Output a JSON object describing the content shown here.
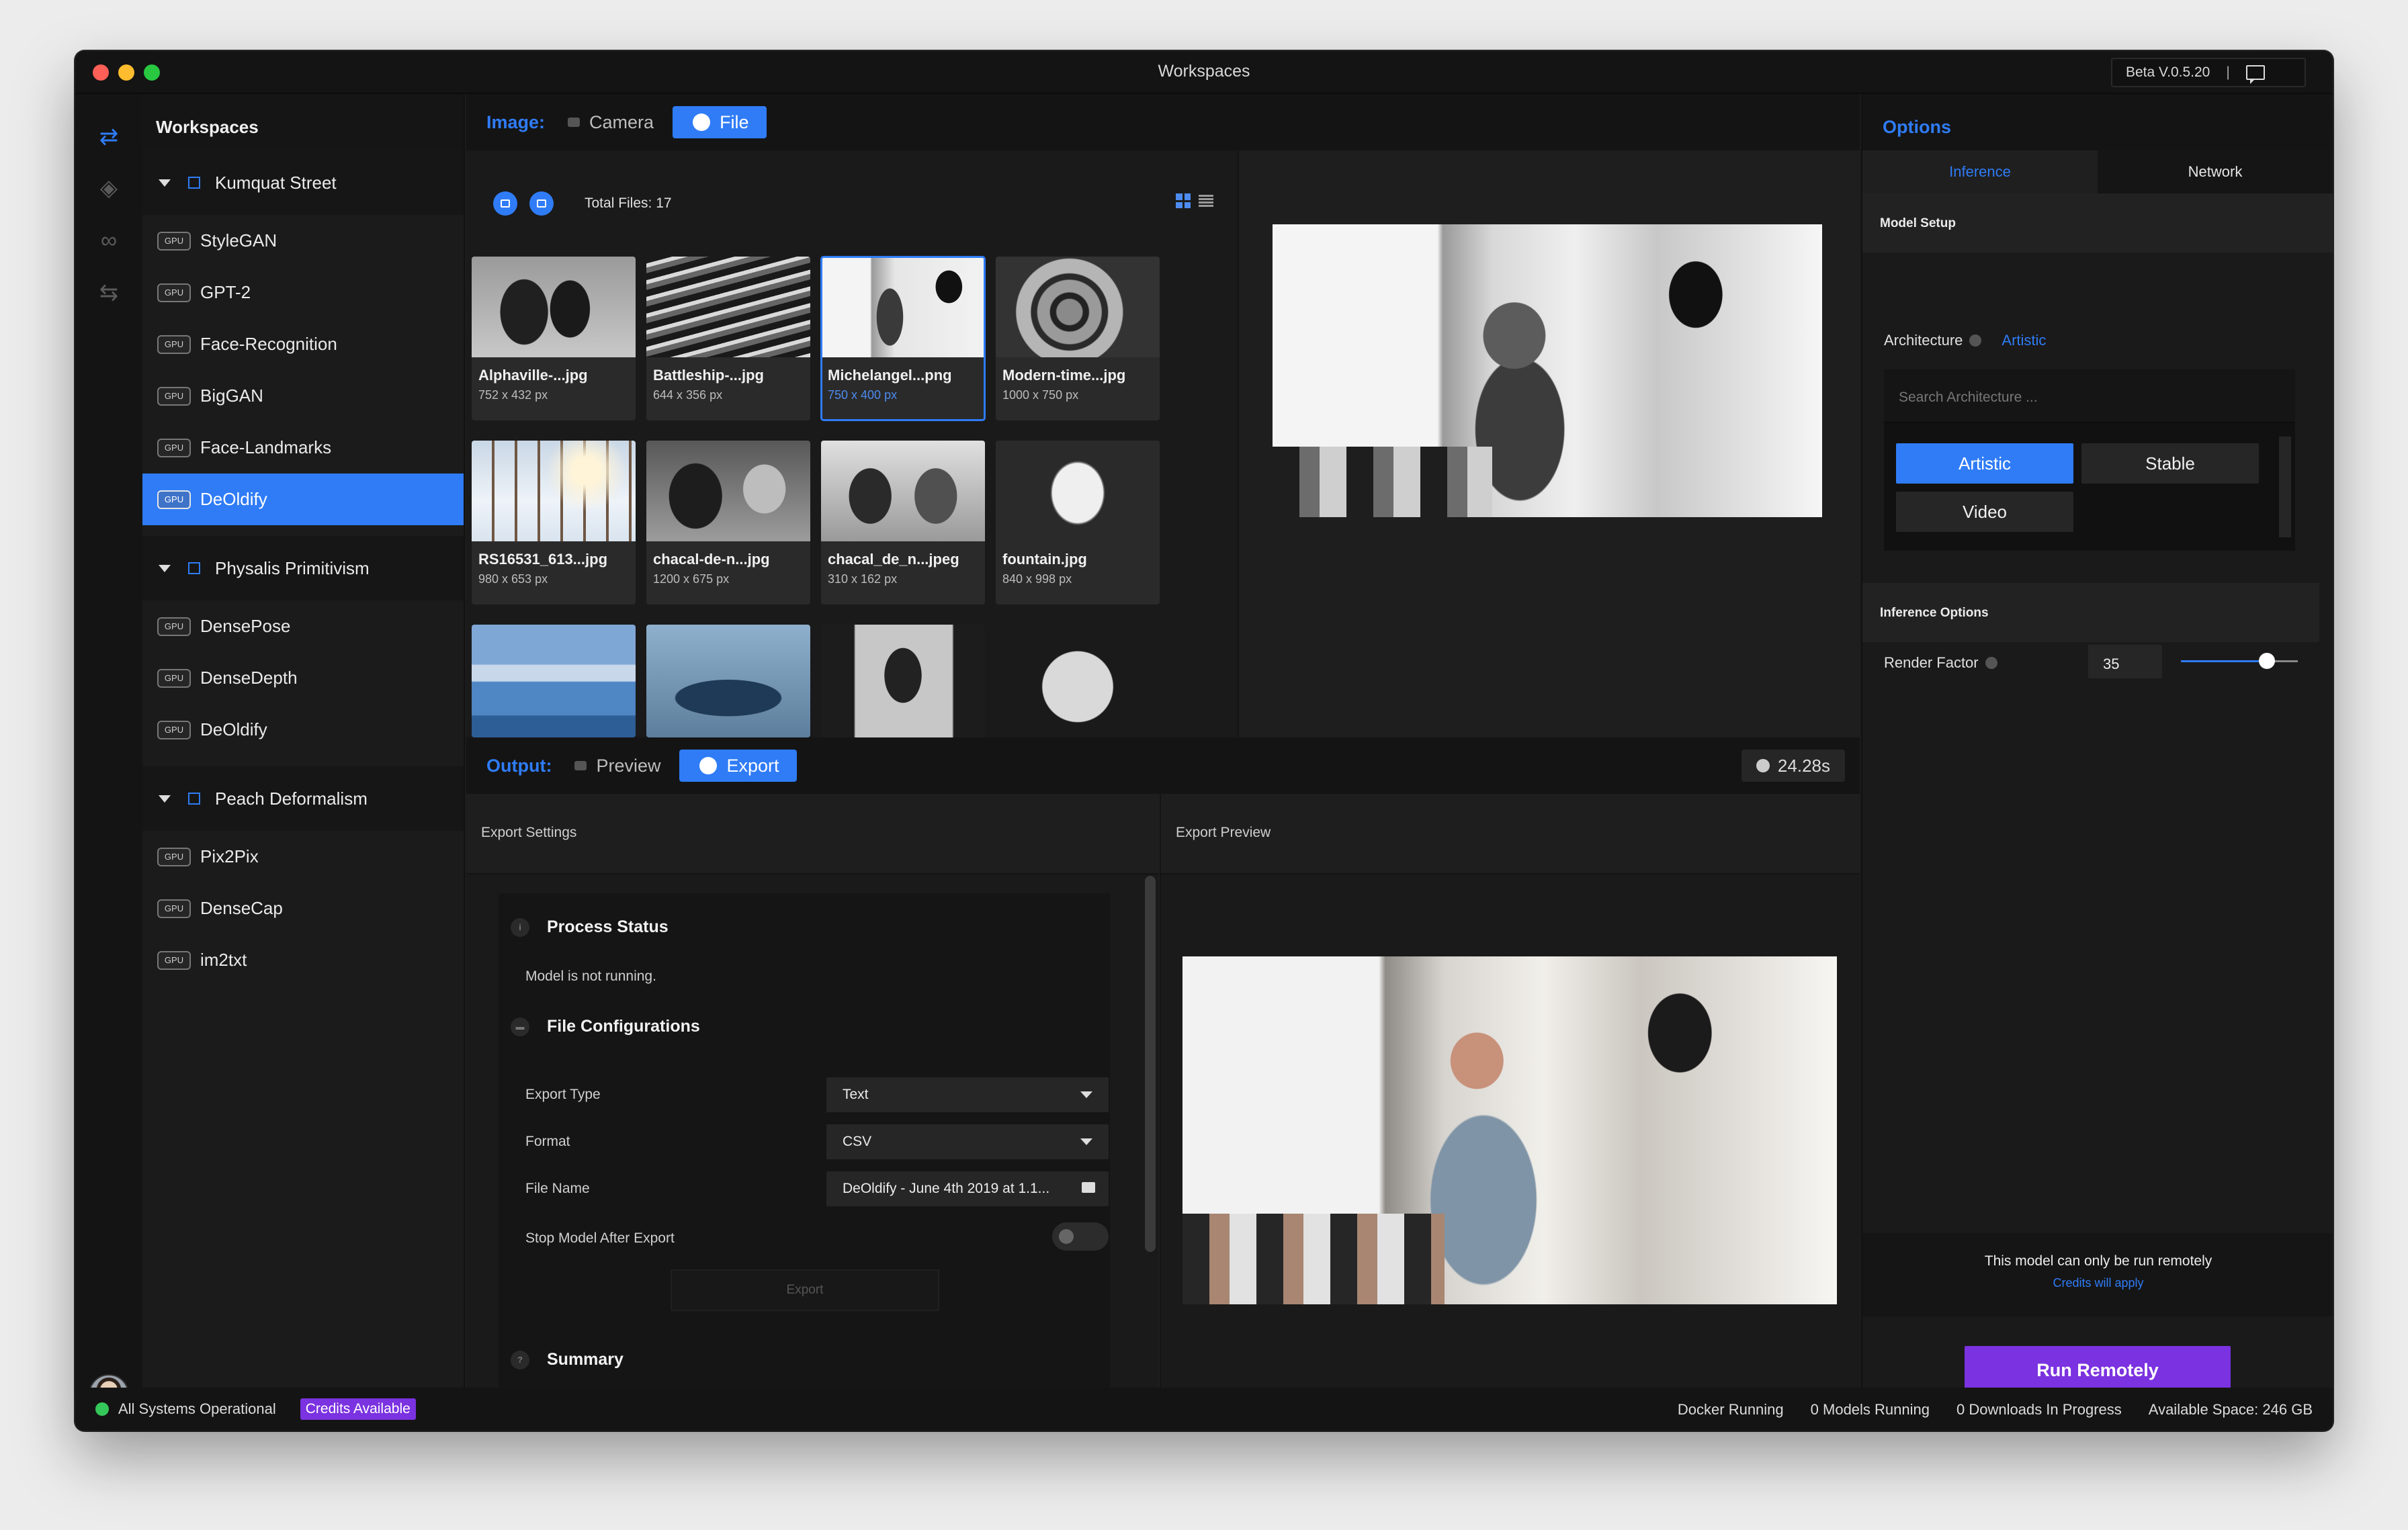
{
  "window": {
    "title": "Workspaces",
    "version": "Beta V.0.5.20",
    "version_sep": "|"
  },
  "sidebar": {
    "title": "Workspaces",
    "gpu_badge": "GPU",
    "groups": [
      {
        "name": "Kumquat Street",
        "items": [
          "StyleGAN",
          "GPT-2",
          "Face-Recognition",
          "BigGAN",
          "Face-Landmarks",
          "DeOldify"
        ]
      },
      {
        "name": "Physalis Primitivism",
        "items": [
          "DensePose",
          "DenseDepth",
          "DeOldify"
        ]
      },
      {
        "name": "Peach Deformalism",
        "items": [
          "Pix2Pix",
          "DenseCap",
          "im2txt"
        ]
      }
    ]
  },
  "image_bar": {
    "label": "Image:",
    "camera": "Camera",
    "file": "File"
  },
  "gallery": {
    "total_files": "Total Files: 17",
    "tiles": [
      {
        "name": "Alphaville-...jpg",
        "dim": "752 x 432 px"
      },
      {
        "name": "Battleship-...jpg",
        "dim": "644 x 356 px"
      },
      {
        "name": "Michelangel...png",
        "dim": "750 x 400 px"
      },
      {
        "name": "Modern-time...jpg",
        "dim": "1000 x 750 px"
      },
      {
        "name": "RS16531_613...jpg",
        "dim": "980 x 653 px"
      },
      {
        "name": "chacal-de-n...jpg",
        "dim": "1200 x 675 px"
      },
      {
        "name": "chacal_de_n...jpeg",
        "dim": "310 x 162 px"
      },
      {
        "name": "fountain.jpg",
        "dim": "840 x 998 px"
      }
    ]
  },
  "output_bar": {
    "label": "Output:",
    "preview": "Preview",
    "export": "Export",
    "timer": "24.28s"
  },
  "export_settings": {
    "title": "Export Settings",
    "process_status": "Process Status",
    "status_text": "Model is not running.",
    "file_config": "File Configurations",
    "export_type_label": "Export Type",
    "export_type_value": "Text",
    "format_label": "Format",
    "format_value": "CSV",
    "file_name_label": "File Name",
    "file_name_value": "DeOldify - June 4th 2019 at 1.1...",
    "stop_label": "Stop Model After Export",
    "export_button": "Export",
    "summary": "Summary",
    "icon_process": "i",
    "icon_summary": "?"
  },
  "export_preview": {
    "title": "Export Preview"
  },
  "options": {
    "title": "Options",
    "tabs": [
      "Inference",
      "Network"
    ],
    "model_setup": "Model Setup",
    "architecture_label": "Architecture",
    "architecture_value": "Artistic",
    "search_placeholder": "Search Architecture ...",
    "chips": [
      "Artistic",
      "Stable",
      "Video"
    ],
    "inference_options": "Inference Options",
    "render_factor_label": "Render Factor",
    "render_factor_value": "35",
    "remote_note": "This model can only be run remotely",
    "credits_note": "Credits will apply",
    "run_button": "Run Remotely"
  },
  "statusbar": {
    "systems": "All Systems Operational",
    "credits": "Credits Available",
    "docker": "Docker Running",
    "models": "0 Models Running",
    "downloads": "0 Downloads In Progress",
    "space": "Available Space: 246 GB"
  },
  "colors": {
    "accent": "#2f7cf6",
    "purple": "#7b32e0",
    "ok": "#34c759"
  }
}
